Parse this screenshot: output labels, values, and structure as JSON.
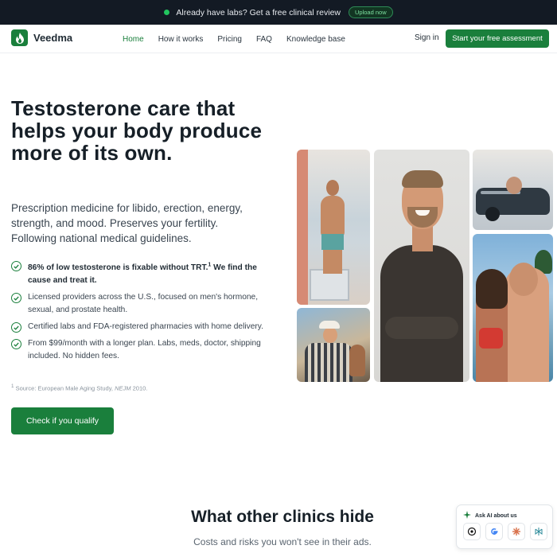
{
  "announcement": {
    "text": "Already have labs? Get a free clinical review",
    "button": "Upload now"
  },
  "nav": {
    "brand": "Veedma",
    "items": [
      "Home",
      "How it works",
      "Pricing",
      "FAQ",
      "Knowledge base"
    ],
    "active": "Home",
    "sign_in": "Sign in",
    "cta": "Start your free assessment"
  },
  "hero": {
    "headline": "Testosterone care that helps your body produce more of its own.",
    "subhead": "Prescription medicine for libido, erection, energy, strength, and mood. Preserves your fertility. Following national medical guidelines.",
    "benefits": [
      {
        "bold": "86% of low testosterone is fixable without TRT.",
        "sup": "1",
        "rest": " We find the cause and treat it."
      },
      {
        "text": "Licensed providers across the U.S., focused on men's hormone, sexual, and prostate health."
      },
      {
        "text": "Certified labs and FDA-registered pharmacies with home delivery."
      },
      {
        "text": "From $99/month with a longer plan. Labs, meds, doctor, shipping included. No hidden fees."
      }
    ],
    "source": {
      "sup": "1",
      "prefix": " Source: European Male Aging Study, ",
      "journal": "NEJM",
      "year": " 2010."
    },
    "cta": "Check if you qualify"
  },
  "section2": {
    "title": "What other clinics hide",
    "subtitle": "Costs and risks you won't see in their ads."
  },
  "ask_ai": {
    "title": "Ask AI about us",
    "icons": [
      "chatgpt-icon",
      "google-icon",
      "claude-icon",
      "perplexity-icon"
    ]
  },
  "colors": {
    "brand_green": "#1a7f3c",
    "announce_bg": "#131a24",
    "heading": "#161f27"
  }
}
